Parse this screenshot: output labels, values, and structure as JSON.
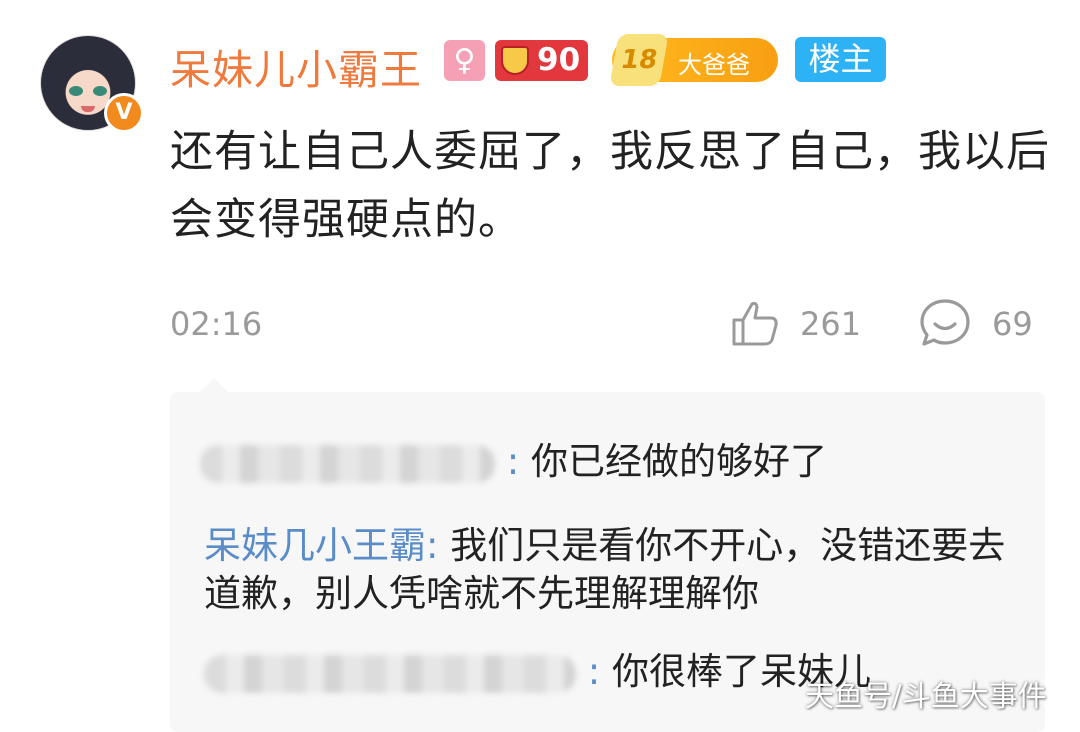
{
  "post": {
    "username": "呆妹儿小霸王",
    "avatar_badge": "V",
    "badge_female_icon": "female-symbol-icon",
    "level_badge": "90",
    "fan_badge": {
      "level": "18",
      "name": "大爸爸"
    },
    "owner_badge": "楼主",
    "content": "还有让自己人委屈了，我反思了自己，我以后会变得强硬点的。",
    "time": "02:16",
    "likes": "261",
    "replies_count": "69"
  },
  "replies": [
    {
      "name": "",
      "colon": ":",
      "text": "你已经做的够好了"
    },
    {
      "name": "呆妹几小王霸",
      "colon": ":",
      "text": "我们只是看你不开心，没错还要去道歉，别人凭啥就不先理解理解你"
    },
    {
      "name": "",
      "colon": ":",
      "text": "你很棒了呆妹儿"
    }
  ],
  "watermark": "天鱼号/斗鱼大事件",
  "colors": {
    "username": "#f07a3c",
    "reply_name": "#5a8cc8",
    "owner_badge": "#2db3f5",
    "level_badge": "#e2373d",
    "fan_badge": "#f8a314"
  }
}
